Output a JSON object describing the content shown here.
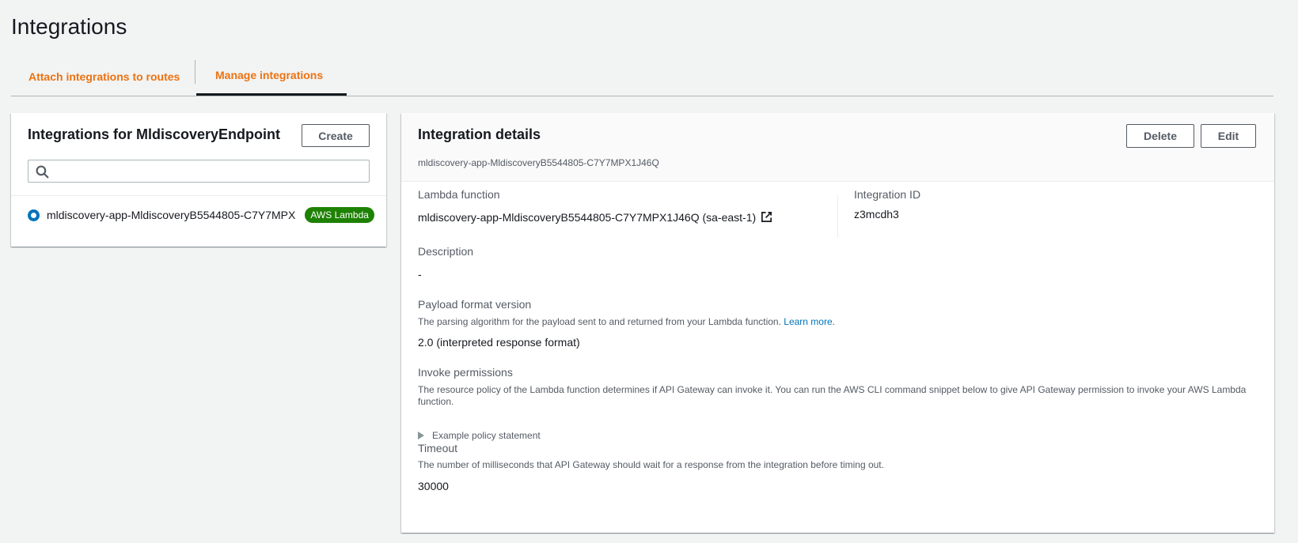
{
  "page": {
    "title": "Integrations"
  },
  "tabs": [
    {
      "label": "Attach integrations to routes",
      "active": false
    },
    {
      "label": "Manage integrations",
      "active": true
    }
  ],
  "left_panel": {
    "title": "Integrations for MldiscoveryEndpoint",
    "create_label": "Create",
    "search": {
      "value": "",
      "placeholder": ""
    },
    "items": [
      {
        "label": "mldiscovery-app-MldiscoveryB5544805-C7Y7MPX",
        "badge": "AWS Lambda",
        "selected": true
      }
    ]
  },
  "details": {
    "title": "Integration details",
    "subtitle": "mldiscovery-app-MldiscoveryB5544805-C7Y7MPX1J46Q",
    "delete_label": "Delete",
    "edit_label": "Edit",
    "lambda_function": {
      "label": "Lambda function",
      "value": "mldiscovery-app-MldiscoveryB5544805-C7Y7MPX1J46Q (sa-east-1)"
    },
    "integration_id": {
      "label": "Integration ID",
      "value": "z3mcdh3"
    },
    "description": {
      "label": "Description",
      "value": "-"
    },
    "payload": {
      "label": "Payload format version",
      "desc": "The parsing algorithm for the payload sent to and returned from your Lambda function.",
      "learn_more": "Learn more.",
      "value": "2.0 (interpreted response format)"
    },
    "invoke": {
      "label": "Invoke permissions",
      "desc": "The resource policy of the Lambda function determines if API Gateway can invoke it. You can run the AWS CLI command snippet below to give API Gateway permission to invoke your AWS Lambda function.",
      "expander": "Example policy statement"
    },
    "timeout": {
      "label": "Timeout",
      "desc": "The number of milliseconds that API Gateway should wait for a response from the integration before timing out.",
      "value": "30000"
    }
  },
  "colors": {
    "accent": "#ec7211",
    "link": "#0073bb",
    "badge": "#1d8102",
    "background": "#f2f3f3"
  },
  "icons": [
    "search-icon",
    "external-link-icon",
    "caret-right-icon"
  ]
}
